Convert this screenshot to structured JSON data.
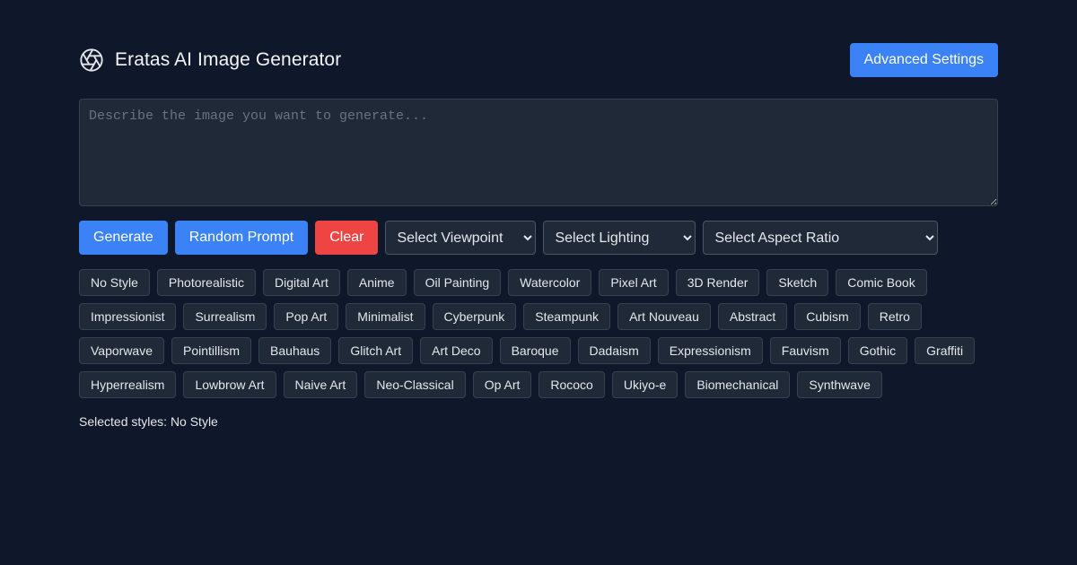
{
  "header": {
    "title": "Eratas AI Image Generator",
    "logo_icon": "aperture-icon",
    "advanced_settings_label": "Advanced Settings"
  },
  "prompt": {
    "value": "",
    "placeholder": "Describe the image you want to generate..."
  },
  "controls": {
    "generate_label": "Generate",
    "random_label": "Random Prompt",
    "clear_label": "Clear",
    "viewpoint_selected": "Select Viewpoint",
    "lighting_selected": "Select Lighting",
    "aspect_ratio_selected": "Select Aspect Ratio"
  },
  "styles": {
    "rows": [
      [
        "No Style",
        "Photorealistic",
        "Digital Art",
        "Anime",
        "Oil Painting",
        "Watercolor",
        "Pixel Art",
        "3D Render",
        "Sketch",
        "Comic Book"
      ],
      [
        "Impressionist",
        "Surrealism",
        "Pop Art",
        "Minimalist",
        "Cyberpunk",
        "Steampunk",
        "Art Nouveau",
        "Abstract",
        "Cubism",
        "Retro"
      ],
      [
        "Vaporwave",
        "Pointillism",
        "Bauhaus",
        "Glitch Art",
        "Art Deco",
        "Baroque",
        "Dadaism",
        "Expressionism",
        "Fauvism",
        "Gothic",
        "Graffiti"
      ],
      [
        "Hyperrealism",
        "Lowbrow Art",
        "Naive Art",
        "Neo-Classical",
        "Op Art",
        "Rococo",
        "Ukiyo-e",
        "Biomechanical",
        "Synthwave"
      ]
    ]
  },
  "selected": {
    "text": "Selected styles: No Style"
  },
  "colors": {
    "background": "#0f172a",
    "accent": "#3b82f6",
    "danger": "#ef4444",
    "surface": "#1f2937"
  }
}
